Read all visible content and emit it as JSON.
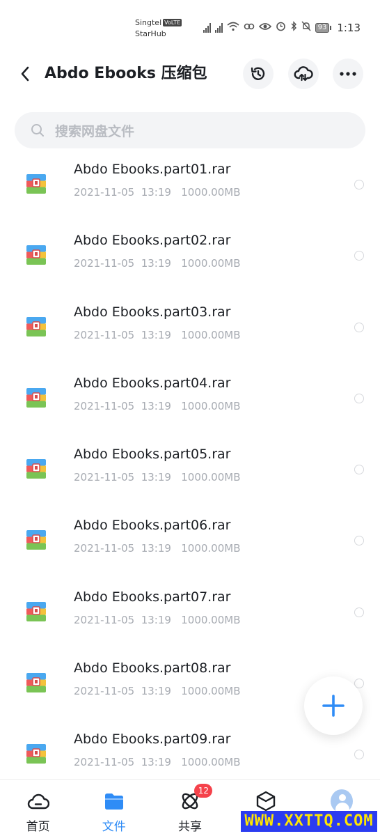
{
  "status_bar": {
    "carrier_1": "Singtel",
    "volte": "VoLTE",
    "carrier_2": "StarHub",
    "battery": "93",
    "time": "1:13"
  },
  "header": {
    "title": "Abdo Ebooks 压缩包"
  },
  "search": {
    "placeholder": "搜索网盘文件"
  },
  "files": [
    {
      "name": "Abdo Ebooks.part01.rar",
      "meta": "2021-11-05  13:19   1000.00MB"
    },
    {
      "name": "Abdo Ebooks.part02.rar",
      "meta": "2021-11-05  13:19   1000.00MB"
    },
    {
      "name": "Abdo Ebooks.part03.rar",
      "meta": "2021-11-05  13:19   1000.00MB"
    },
    {
      "name": "Abdo Ebooks.part04.rar",
      "meta": "2021-11-05  13:19   1000.00MB"
    },
    {
      "name": "Abdo Ebooks.part05.rar",
      "meta": "2021-11-05  13:19   1000.00MB"
    },
    {
      "name": "Abdo Ebooks.part06.rar",
      "meta": "2021-11-05  13:19   1000.00MB"
    },
    {
      "name": "Abdo Ebooks.part07.rar",
      "meta": "2021-11-05  13:19   1000.00MB"
    },
    {
      "name": "Abdo Ebooks.part08.rar",
      "meta": "2021-11-05  13:19   1000.00MB"
    },
    {
      "name": "Abdo Ebooks.part09.rar",
      "meta": "2021-11-05  13:19   1000.00MB"
    }
  ],
  "nav": {
    "items": [
      {
        "label": "首页",
        "icon": "cloud-home-icon"
      },
      {
        "label": "文件",
        "icon": "folder-icon"
      },
      {
        "label": "共享",
        "icon": "atom-share-icon"
      },
      {
        "label": "",
        "icon": "cube-icon"
      },
      {
        "label": "",
        "icon": "avatar-icon"
      }
    ],
    "share_badge": "12"
  },
  "watermark": "WWW.XXTTQ.COM",
  "colors": {
    "accent": "#2f8cf6",
    "badge": "#f5424b",
    "title": "#1c1f24",
    "meta": "#a7abb2"
  }
}
